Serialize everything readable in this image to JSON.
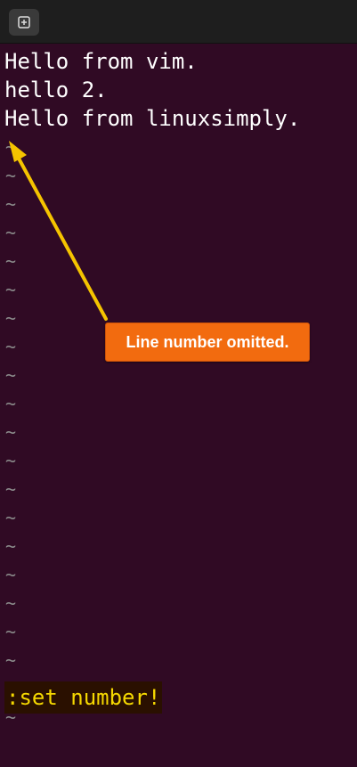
{
  "window": {
    "new_tab_icon": "new-tab-icon"
  },
  "editor": {
    "lines": [
      "Hello from vim.",
      "hello 2.",
      "Hello from linuxsimply."
    ],
    "empty_line_marker": "~",
    "empty_line_count": 21,
    "command": ":set number!"
  },
  "annotation": {
    "text": "Line number omitted.",
    "color": "#f26b0f",
    "arrow_color": "#f5c400"
  },
  "colors": {
    "background": "#300a24",
    "text": "#ffffff",
    "tilde": "#8a8a8a",
    "command_text": "#f5d800"
  }
}
